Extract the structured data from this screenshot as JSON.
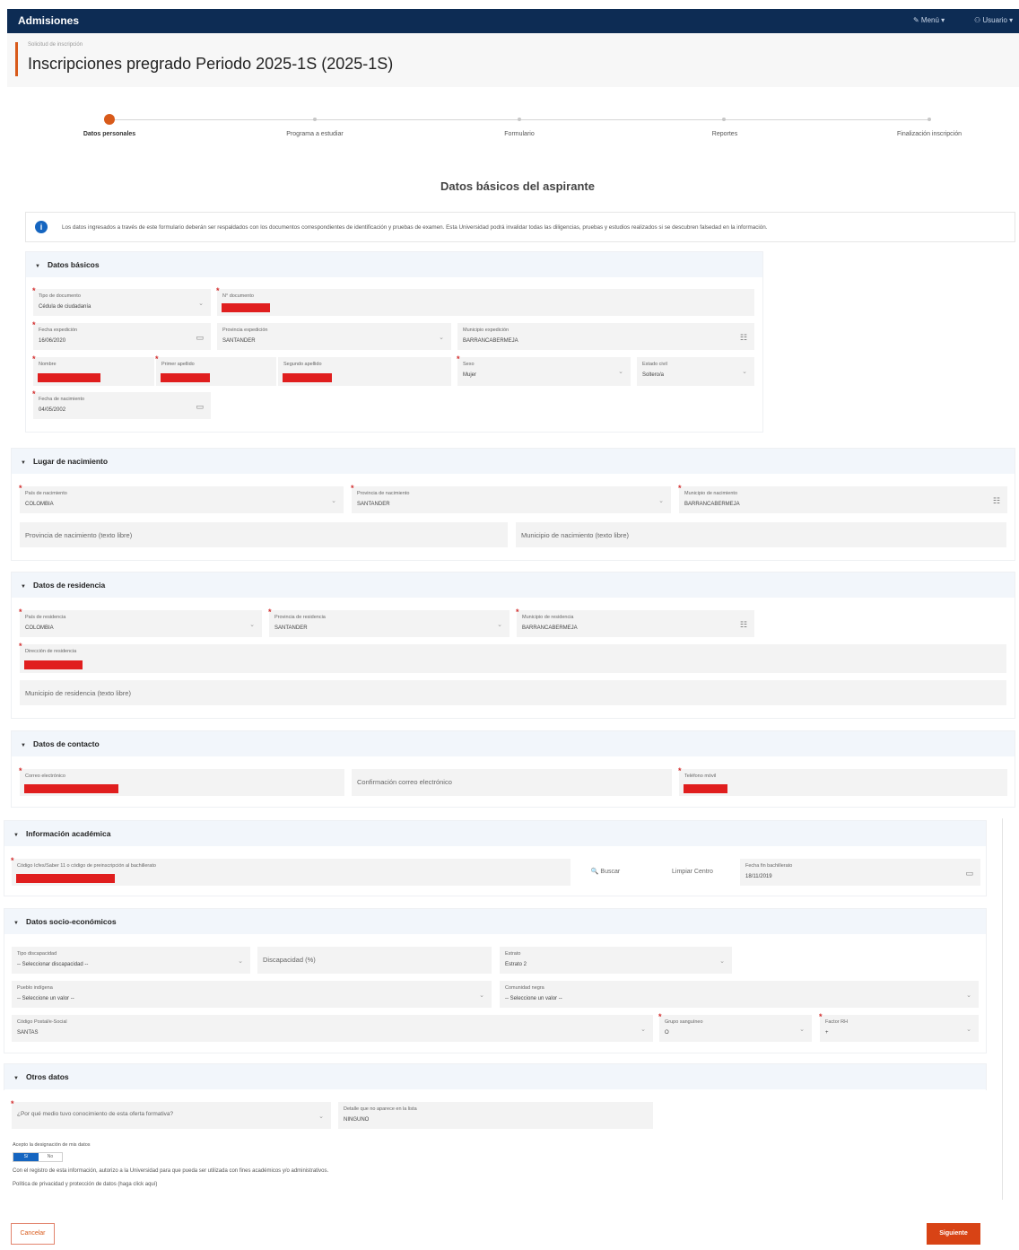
{
  "topbar": {
    "brand": "Admisiones",
    "menu_help": "✎ Menú ▾",
    "menu_user": "⚇ Usuario ▾"
  },
  "header": {
    "breadcrumb": "Solicitud de inscripción",
    "title": "Inscripciones pregrado Periodo 2025-1S (2025-1S)"
  },
  "stepper": {
    "steps": [
      "Datos personales",
      "Programa a estudiar",
      "Formulario",
      "Reportes",
      "Finalización inscripción"
    ],
    "active_index": 0
  },
  "main": {
    "section_title": "Datos básicos del aspirante",
    "info_text": "Los datos ingresados a través de este formulario deberán ser respaldados con los documentos correspondientes de identificación y pruebas de examen. Esta Universidad podrá invalidar todas las diligencias, pruebas y estudios realizados si se descubren falsedad en la información."
  },
  "datos_basicos": {
    "title": "Datos básicos",
    "tipo_documento": {
      "label": "Tipo de documento",
      "value": "Cédula de ciudadanía"
    },
    "numero_documento": {
      "label": "N° documento"
    },
    "fecha_expedicion": {
      "label": "Fecha expedición",
      "value": "16/06/2020"
    },
    "provincia_expedicion": {
      "label": "Provincia expedición",
      "value": "SANTANDER"
    },
    "municipio_expedicion": {
      "label": "Municipio expedición",
      "value": "BARRANCABERMEJA"
    },
    "nombre": {
      "label": "Nombre"
    },
    "primer_apellido": {
      "label": "Primer apellido"
    },
    "segundo_apellido": {
      "label": "Segundo apellido"
    },
    "sexo": {
      "label": "Sexo",
      "value": "Mujer"
    },
    "estado_civil": {
      "label": "Estado civil",
      "value": "Soltero/a"
    },
    "fecha_nacimiento": {
      "label": "Fecha de nacimiento",
      "value": "04/05/2002"
    }
  },
  "lugar_nacimiento": {
    "title": "Lugar de nacimiento",
    "pais": {
      "label": "País de nacimiento",
      "value": "COLOMBIA"
    },
    "provincia": {
      "label": "Provincia de nacimiento",
      "value": "SANTANDER"
    },
    "municipio": {
      "label": "Municipio de nacimiento",
      "value": "BARRANCABERMEJA"
    },
    "provincia_libre": {
      "placeholder": "Provincia de nacimiento (texto libre)"
    },
    "municipio_libre": {
      "placeholder": "Municipio de nacimiento (texto libre)"
    }
  },
  "residencia": {
    "title": "Datos de residencia",
    "pais": {
      "label": "País de residencia",
      "value": "COLOMBIA"
    },
    "provincia": {
      "label": "Provincia de residencia",
      "value": "SANTANDER"
    },
    "municipio": {
      "label": "Municipio de residencia",
      "value": "BARRANCABERMEJA"
    },
    "direccion": {
      "label": "Dirección de residencia"
    },
    "municipio_libre": {
      "placeholder": "Municipio de residencia (texto libre)"
    }
  },
  "contacto": {
    "title": "Datos de contacto",
    "correo": {
      "label": "Correo electrónico"
    },
    "confirmacion": {
      "placeholder": "Confirmación correo electrónico"
    },
    "telefono": {
      "label": "Teléfono móvil"
    }
  },
  "academica": {
    "title": "Información académica",
    "codigo": {
      "label": "Código Icfes/Saber 11 o código de preinscripción al bachillerato"
    },
    "buscar_label": "🔍 Buscar",
    "limpiar_label": "Limpiar Centro",
    "fecha_bachillerato": {
      "label": "Fecha fin bachillerato",
      "value": "18/11/2019"
    }
  },
  "socioeconomicos": {
    "title": "Datos socio-económicos",
    "tipo_discapacidad": {
      "label": "Tipo discapacidad",
      "value": "-- Seleccionar discapacidad --"
    },
    "discapacidad_pct": {
      "placeholder": "Discapacidad (%)"
    },
    "estrato": {
      "label": "Estrato",
      "value": "Estrato 2"
    },
    "pueblo_indigena": {
      "label": "Pueblo indígena",
      "value": "-- Seleccione un valor --"
    },
    "comunidad_negra": {
      "label": "Comunidad negra",
      "value": "-- Seleccione un valor --"
    },
    "codigo_postal": {
      "label": "Código Postal/e-Social",
      "value": "SANTAS"
    },
    "grupo_sanguineo": {
      "label": "Grupo sanguíneo",
      "value": "O"
    },
    "factor_rh": {
      "label": "Factor RH",
      "value": "+"
    }
  },
  "otros": {
    "title": "Otros datos",
    "medio_conocimiento": {
      "value": "¿Por qué medio tuvo conocimiento de esta oferta formativa?"
    },
    "detalle_medio": {
      "label": "Detalle que no aparece en la lista",
      "value": "NINGUNO"
    },
    "designacion_label": "Acepto la designación de mis datos",
    "toggle_si": "Sí",
    "toggle_no": "No",
    "consent_text": "Con el registro de esta información, autorizo a la Universidad para que pueda ser utilizada con fines académicos y/o administrativos.",
    "privacy_text": "Política de privacidad y protección de datos (haga click aquí)"
  },
  "footer": {
    "cancel_label": "Cancelar",
    "next_label": "Siguiente"
  },
  "colors": {
    "navbar": "#0d2c54",
    "accent": "#d85a1a",
    "primary": "#1565c0",
    "redaction": "#e01e1e"
  }
}
